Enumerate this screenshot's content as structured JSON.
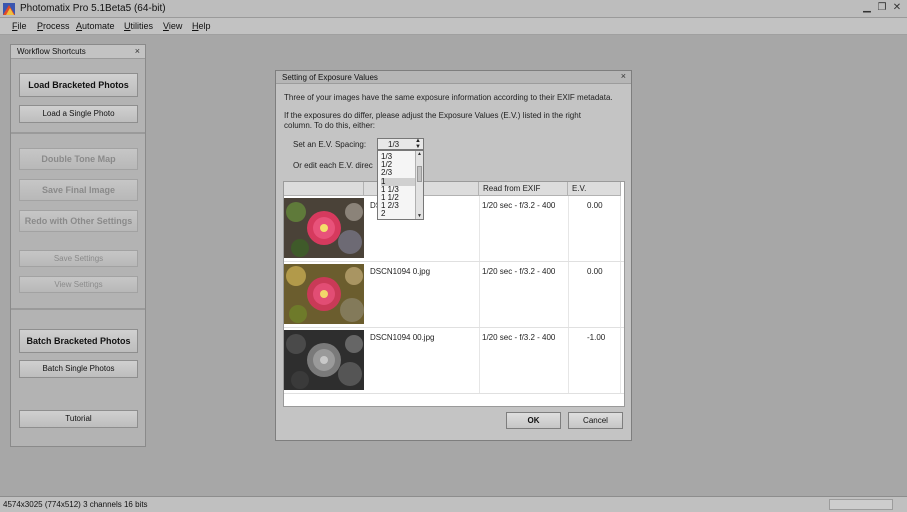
{
  "window": {
    "title": "Photomatix Pro 5.1Beta5 (64-bit)",
    "minimize": "▁",
    "restore": "❐",
    "close": "✕"
  },
  "menu": {
    "items": [
      {
        "label": "File",
        "accel": "F",
        "rest": "ile"
      },
      {
        "label": "Process",
        "accel": "P",
        "rest": "rocess"
      },
      {
        "label": "Automate",
        "accel": "A",
        "rest": "utomate"
      },
      {
        "label": "Utilities",
        "accel": "U",
        "rest": "tilities"
      },
      {
        "label": "View",
        "accel": "V",
        "rest": "iew"
      },
      {
        "label": "Help",
        "accel": "H",
        "rest": "elp"
      }
    ]
  },
  "workflow": {
    "title": "Workflow Shortcuts",
    "close": "×",
    "buttons": {
      "load_bracketed": "Load Bracketed Photos",
      "load_single": "Load a Single Photo",
      "double_tone_map": "Double Tone Map",
      "save_final": "Save Final Image",
      "redo": "Redo with Other Settings",
      "save_settings": "Save Settings",
      "view_settings": "View Settings",
      "batch_bracketed": "Batch Bracketed Photos",
      "batch_single": "Batch Single Photos",
      "tutorial": "Tutorial"
    }
  },
  "dialog": {
    "title": "Setting of Exposure Values",
    "close": "×",
    "line1": "Three of your images have the same exposure information according to their EXIF metadata.",
    "line2": "If the exposures do differ, please adjust the Exposure Values (E.V.) listed in the right",
    "line3": "column. To do this, either:",
    "spacing_label": "Set an E.V. Spacing:",
    "spacing_value": "1/3",
    "or_edit": "Or edit each E.V. direc",
    "dropdown_options": [
      "1/3",
      "1/2",
      "2/3",
      "1",
      "1 1/3",
      "1 1/2",
      "1 2/3",
      "2"
    ],
    "selected_option": "1",
    "table": {
      "headers": [
        "",
        "",
        "Read from EXIF",
        "E.V."
      ],
      "rows": [
        {
          "name": "DS",
          "exif": "1/20 sec - f/3.2 - 400",
          "ev": "0.00"
        },
        {
          "name": "DSCN1094 0.jpg",
          "exif": "1/20 sec - f/3.2 - 400",
          "ev": "0.00"
        },
        {
          "name": "DSCN1094 00.jpg",
          "exif": "1/20 sec - f/3.2 - 400",
          "ev": "-1.00"
        }
      ]
    },
    "ok": "OK",
    "cancel": "Cancel"
  },
  "status": {
    "text": "4574x3025 (774x512) 3 channels 16 bits"
  }
}
